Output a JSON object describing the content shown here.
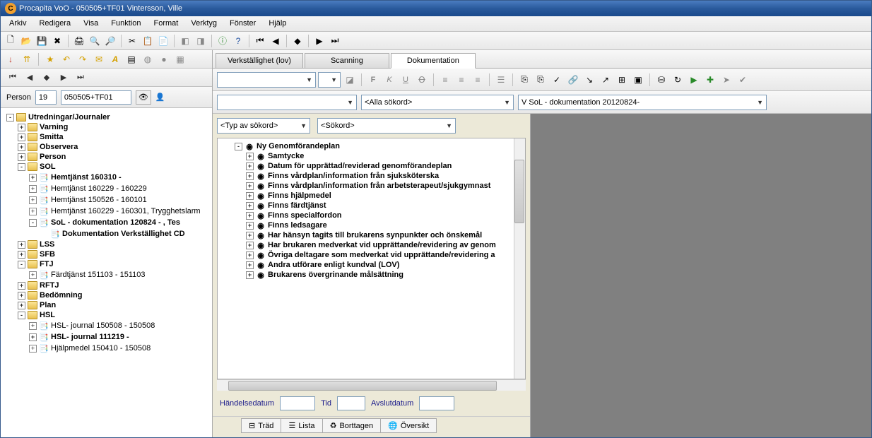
{
  "title": "Procapita VoO - 050505+TF01 Vintersson, Ville",
  "menu": [
    "Arkiv",
    "Redigera",
    "Visa",
    "Funktion",
    "Format",
    "Verktyg",
    "Fönster",
    "Hjälp"
  ],
  "person": {
    "label": "Person",
    "num": "19",
    "id": "050505+TF01"
  },
  "left_tree": [
    {
      "lvl": 0,
      "exp": "-",
      "icon": "folder",
      "label": "Utredningar/Journaler",
      "bold": true
    },
    {
      "lvl": 1,
      "exp": "+",
      "icon": "folder",
      "label": "Varning",
      "bold": true
    },
    {
      "lvl": 1,
      "exp": "+",
      "icon": "folder",
      "label": "Smitta",
      "bold": true
    },
    {
      "lvl": 1,
      "exp": "+",
      "icon": "folder",
      "label": "Observera",
      "bold": true
    },
    {
      "lvl": 1,
      "exp": "+",
      "icon": "folder",
      "label": "Person",
      "bold": true
    },
    {
      "lvl": 1,
      "exp": "-",
      "icon": "folder",
      "label": "SOL",
      "bold": true
    },
    {
      "lvl": 2,
      "exp": "+",
      "icon": "doc",
      "label": "Hemtjänst 160310 -",
      "bold": true
    },
    {
      "lvl": 2,
      "exp": "+",
      "icon": "doc",
      "label": "Hemtjänst 160229 - 160229"
    },
    {
      "lvl": 2,
      "exp": "+",
      "icon": "doc",
      "label": "Hemtjänst 150526 - 160101"
    },
    {
      "lvl": 2,
      "exp": "+",
      "icon": "doc",
      "label": "Hemtjänst 160229 - 160301, Trygghetslarm"
    },
    {
      "lvl": 2,
      "exp": "-",
      "icon": "doc",
      "label": "SoL - dokumentation 120824 - , Tes",
      "bold": true
    },
    {
      "lvl": 3,
      "exp": " ",
      "icon": "doc",
      "label": "Dokumentation Verkställighet CD",
      "bold": true
    },
    {
      "lvl": 1,
      "exp": "+",
      "icon": "folder",
      "label": "LSS",
      "bold": true
    },
    {
      "lvl": 1,
      "exp": "+",
      "icon": "folder",
      "label": "SFB",
      "bold": true
    },
    {
      "lvl": 1,
      "exp": "-",
      "icon": "folder",
      "label": "FTJ",
      "bold": true
    },
    {
      "lvl": 2,
      "exp": "+",
      "icon": "doc",
      "label": "Färdtjänst 151103 - 151103"
    },
    {
      "lvl": 1,
      "exp": "+",
      "icon": "folder",
      "label": "RFTJ",
      "bold": true
    },
    {
      "lvl": 1,
      "exp": "+",
      "icon": "folder",
      "label": "Bedömning",
      "bold": true
    },
    {
      "lvl": 1,
      "exp": "+",
      "icon": "folder",
      "label": "Plan",
      "bold": true
    },
    {
      "lvl": 1,
      "exp": "-",
      "icon": "folder",
      "label": "HSL",
      "bold": true
    },
    {
      "lvl": 2,
      "exp": "+",
      "icon": "doc",
      "label": "HSL- journal 150508 - 150508"
    },
    {
      "lvl": 2,
      "exp": "+",
      "icon": "doc",
      "label": "HSL- journal 111219 -",
      "bold": true
    },
    {
      "lvl": 2,
      "exp": "+",
      "icon": "doc",
      "label": "Hjälpmedel 150410 - 150508"
    }
  ],
  "tabs": {
    "t1": "Verkställighet (lov)",
    "t2": "Scanning",
    "t3": "Dokumentation"
  },
  "search": {
    "all": "<Alla sökord>",
    "journal": "V SoL - dokumentation 20120824-",
    "type": "<Typ av sökord>",
    "sokord": "<Sökord>"
  },
  "doc_tree": [
    {
      "lvl": 0,
      "exp": "-",
      "label": "Ny Genomförandeplan",
      "bold": true
    },
    {
      "lvl": 1,
      "exp": "+",
      "label": "Samtycke",
      "bold": true
    },
    {
      "lvl": 1,
      "exp": "+",
      "label": "Datum för upprättad/reviderad genomförandeplan",
      "bold": true
    },
    {
      "lvl": 1,
      "exp": "+",
      "label": "Finns vårdplan/information från sjuksköterska",
      "bold": true
    },
    {
      "lvl": 1,
      "exp": "+",
      "label": "Finns vårdplan/information från arbetsterapeut/sjukgymnast",
      "bold": true
    },
    {
      "lvl": 1,
      "exp": "+",
      "label": "Finns hjälpmedel",
      "bold": true
    },
    {
      "lvl": 1,
      "exp": "+",
      "label": "Finns färdtjänst",
      "bold": true
    },
    {
      "lvl": 1,
      "exp": "+",
      "label": "Finns specialfordon",
      "bold": true
    },
    {
      "lvl": 1,
      "exp": "+",
      "label": "Finns ledsagare",
      "bold": true
    },
    {
      "lvl": 1,
      "exp": "+",
      "label": "Har hänsyn tagits till brukarens synpunkter och önskemål",
      "bold": true
    },
    {
      "lvl": 1,
      "exp": "+",
      "label": "Har brukaren medverkat vid upprättande/revidering av genom",
      "bold": true
    },
    {
      "lvl": 1,
      "exp": "+",
      "label": "Övriga deltagare som medverkat vid upprättande/revidering a",
      "bold": true
    },
    {
      "lvl": 1,
      "exp": "+",
      "label": "Andra utförare enligt kundval (LOV)",
      "bold": true
    },
    {
      "lvl": 1,
      "exp": "+",
      "label": "Brukarens övergrinande målsättning",
      "bold": true
    }
  ],
  "dates": {
    "handelse": "Händelsedatum",
    "tid": "Tid",
    "avslut": "Avslutdatum"
  },
  "view_tabs": {
    "trad": "Träd",
    "lista": "Lista",
    "bort": "Borttagen",
    "over": "Översikt"
  }
}
